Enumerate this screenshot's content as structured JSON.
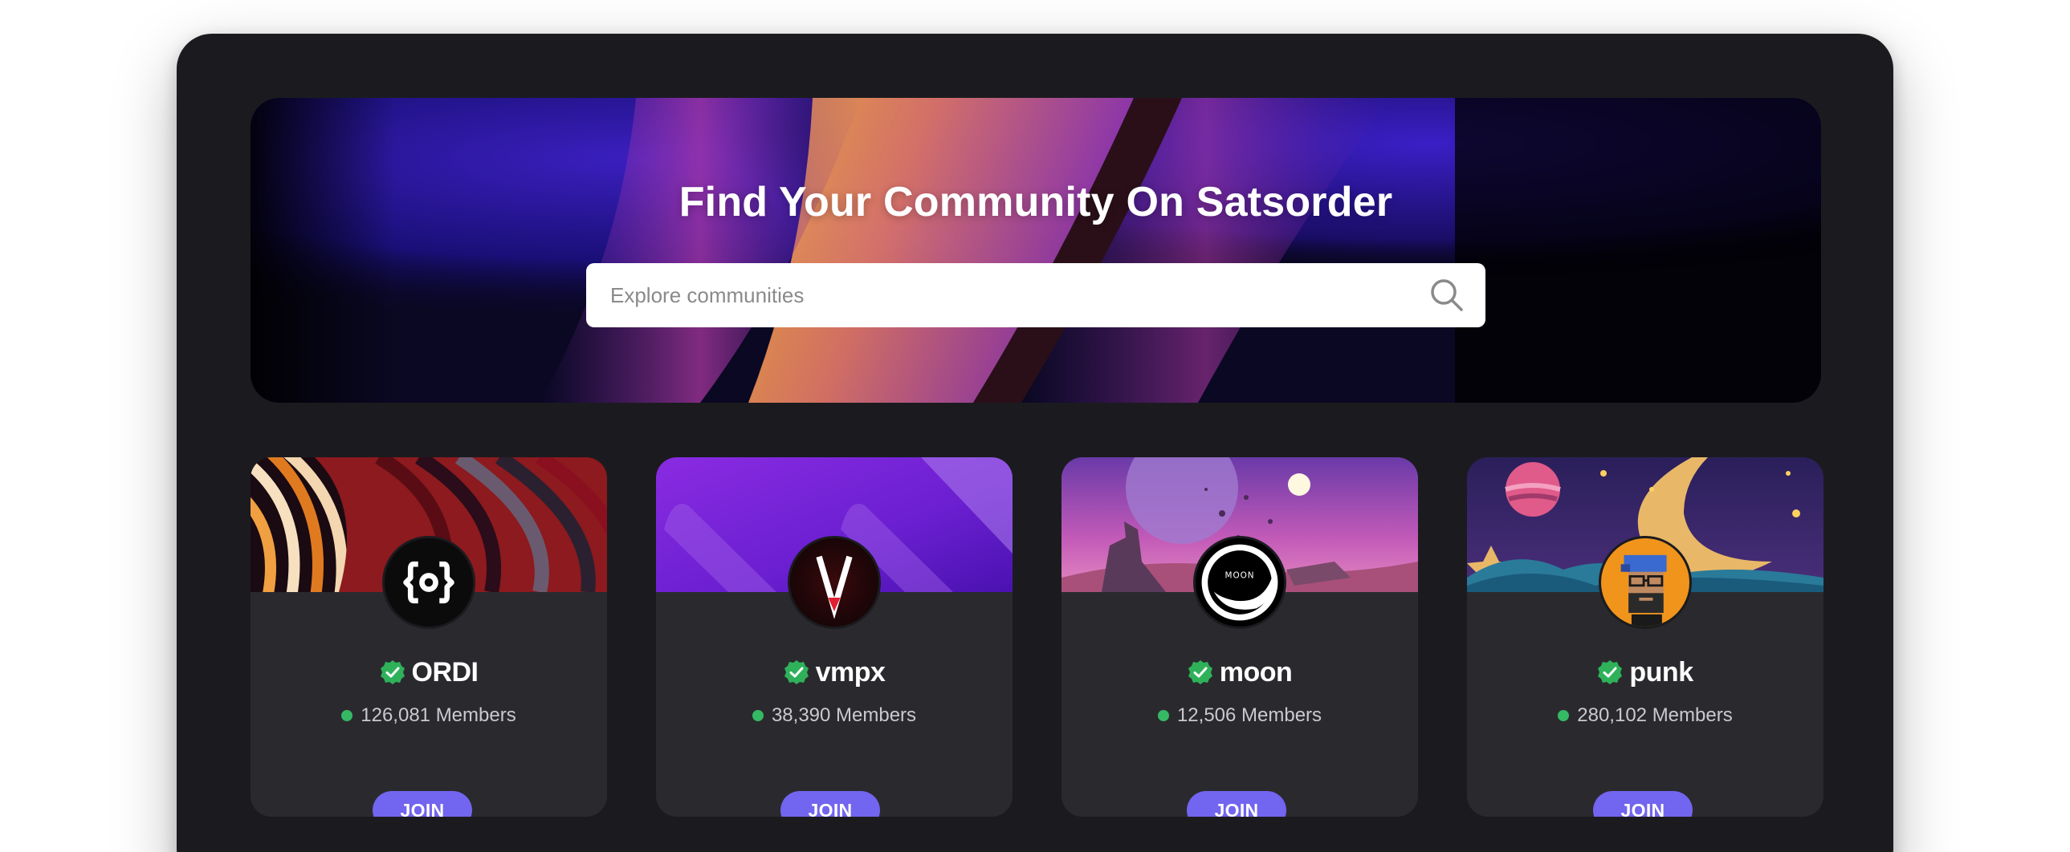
{
  "hero": {
    "title": "Find Your Community On Satsorder",
    "search_placeholder": "Explore communities"
  },
  "communities": [
    {
      "name": "ORDI",
      "members": "126,081 Members",
      "join_label": "JOIN",
      "avatar_icon": "ordi-logo-icon",
      "verified": true
    },
    {
      "name": "vmpx",
      "members": "38,390 Members",
      "join_label": "JOIN",
      "avatar_icon": "vmpx-logo-icon",
      "verified": true
    },
    {
      "name": "moon",
      "members": "12,506 Members",
      "join_label": "JOIN",
      "avatar_icon": "moon-logo-icon",
      "verified": true
    },
    {
      "name": "punk",
      "members": "280,102 Members",
      "join_label": "JOIN",
      "avatar_icon": "punk-avatar-icon",
      "verified": true
    }
  ],
  "colors": {
    "panel_bg": "#1b1b1f",
    "card_bg": "#2a2a2e",
    "accent": "#7265ef",
    "online_dot": "#35b964",
    "verified_badge": "#2fb15a"
  }
}
